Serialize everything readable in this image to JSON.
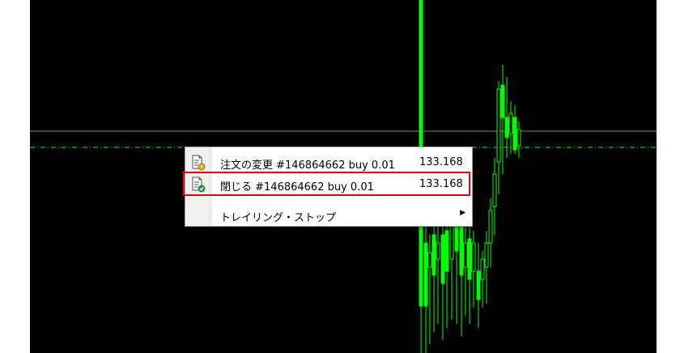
{
  "context_menu": {
    "items": [
      {
        "label": "注文の変更 #146864662 buy 0.01",
        "price": "133.168",
        "icon": "order-modify-icon"
      },
      {
        "label": "閉じる #146864662 buy 0.01",
        "price": "133.168",
        "icon": "order-close-icon",
        "highlighted": true
      },
      {
        "label": "トレイリング・ストップ",
        "price": "",
        "icon": "",
        "submenu": true
      }
    ]
  },
  "colors": {
    "chart_background": "#000000",
    "candle": "#00ff00",
    "bid_line": "#778899",
    "order_line": "#00ff00",
    "highlight": "#e60012"
  }
}
